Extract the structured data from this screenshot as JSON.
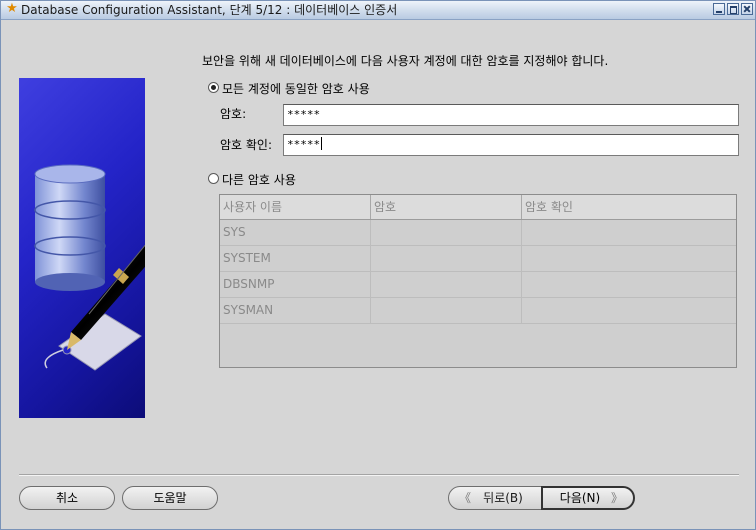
{
  "window": {
    "title": "Database Configuration Assistant, 단계 5/12 : 데이터베이스 인증서",
    "title_icon": "star-icon"
  },
  "main": {
    "instruction": "보안을 위해 새 데이터베이스에 다음 사용자 계정에 대한 암호를 지정해야 합니다.",
    "option_same": {
      "label": "모든 계정에 동일한 암호 사용",
      "selected": true
    },
    "password": {
      "label": "암호:",
      "value": "*****"
    },
    "confirm": {
      "label": "암호 확인:",
      "value": "*****"
    },
    "option_different": {
      "label": "다른 암호 사용",
      "selected": false
    },
    "table": {
      "columns": [
        "사용자 이름",
        "암호",
        "암호 확인"
      ],
      "rows": [
        {
          "user": "SYS",
          "password": "",
          "confirm": ""
        },
        {
          "user": "SYSTEM",
          "password": "",
          "confirm": ""
        },
        {
          "user": "DBSNMP",
          "password": "",
          "confirm": ""
        },
        {
          "user": "SYSMAN",
          "password": "",
          "confirm": ""
        }
      ]
    }
  },
  "buttons": {
    "cancel": "취소",
    "help": "도움말",
    "back": "뒤로(B)",
    "next": "다음(N)"
  },
  "colors": {
    "side_panel": "#2424c8",
    "window_bg": "#d6d6d6",
    "disabled_text": "#8a8a8a"
  }
}
